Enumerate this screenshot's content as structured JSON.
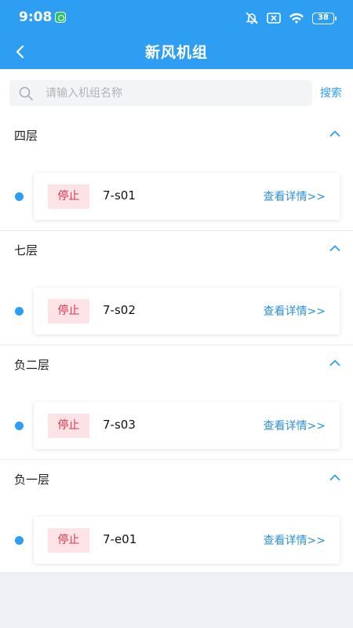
{
  "status_bar": {
    "time": "9:08",
    "battery": "38",
    "icons": [
      "app-notification-icon",
      "mute-icon",
      "sim-off-icon",
      "wifi-icon",
      "battery-icon"
    ]
  },
  "nav": {
    "title": "新风机组",
    "back_icon": "chevron-left-icon"
  },
  "search": {
    "placeholder": "请输入机组名称",
    "value": "",
    "button_label": "搜索"
  },
  "colors": {
    "primary": "#2d9ef2",
    "stopped_bg": "#fde3e6",
    "stopped_text": "#d6334b",
    "link": "#2d8fd6"
  },
  "groups": [
    {
      "title": "四层",
      "expanded": true,
      "units": [
        {
          "status": "停止",
          "name": "7-s01",
          "detail": "查看详情>>"
        }
      ]
    },
    {
      "title": "七层",
      "expanded": true,
      "units": [
        {
          "status": "停止",
          "name": "7-s02",
          "detail": "查看详情>>"
        }
      ]
    },
    {
      "title": "负二层",
      "expanded": true,
      "units": [
        {
          "status": "停止",
          "name": "7-s03",
          "detail": "查看详情>>"
        }
      ]
    },
    {
      "title": "负一层",
      "expanded": true,
      "units": [
        {
          "status": "停止",
          "name": "7-e01",
          "detail": "查看详情>>"
        }
      ]
    }
  ]
}
